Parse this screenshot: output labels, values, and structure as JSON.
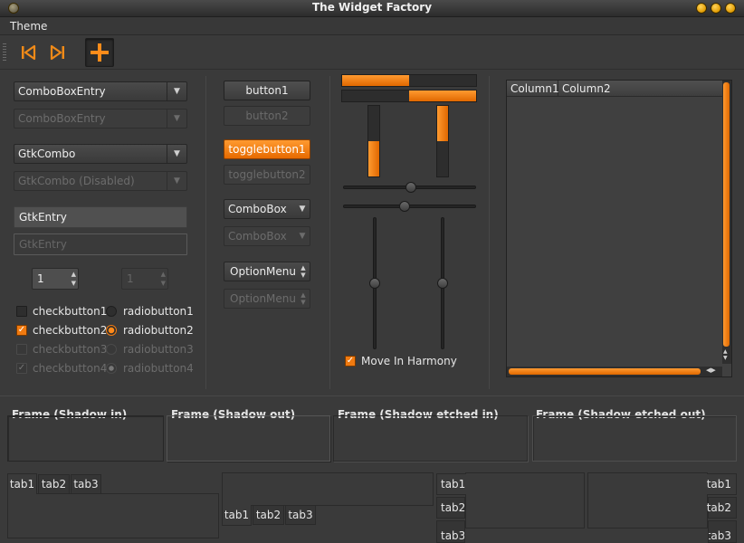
{
  "window": {
    "title": "The Widget Factory"
  },
  "menubar": {
    "items": [
      "Theme"
    ]
  },
  "toolbar": {
    "buttons": [
      "skip-back-icon",
      "skip-forward-icon",
      "plus-icon"
    ]
  },
  "combos": {
    "entry": "ComboBoxEntry",
    "entry_disabled": "ComboBoxEntry",
    "gtk": "GtkCombo",
    "gtk_disabled": "GtkCombo (Disabled)"
  },
  "entries": {
    "entry": "GtkEntry",
    "entry_disabled": "GtkEntry"
  },
  "spin": {
    "value": "1",
    "value_disabled": "1"
  },
  "checks": [
    {
      "label": "checkbutton1",
      "checked": false,
      "disabled": false
    },
    {
      "label": "checkbutton2",
      "checked": true,
      "disabled": false
    },
    {
      "label": "checkbutton3",
      "checked": false,
      "disabled": true
    },
    {
      "label": "checkbutton4",
      "checked": true,
      "disabled": true
    }
  ],
  "radios": [
    {
      "label": "radiobutton1",
      "selected": false,
      "disabled": false
    },
    {
      "label": "radiobutton2",
      "selected": true,
      "disabled": false
    },
    {
      "label": "radiobutton3",
      "selected": false,
      "disabled": true
    },
    {
      "label": "radiobutton4",
      "selected": true,
      "disabled": true
    }
  ],
  "buttons": {
    "button1": "button1",
    "button2": "button2",
    "toggle1": "togglebutton1",
    "toggle2": "togglebutton2",
    "combobox": "ComboBox",
    "combobox_disabled": "ComboBox",
    "optionmenu": "OptionMenu",
    "optionmenu_disabled": "OptionMenu"
  },
  "progress": {
    "h_top": 0.5,
    "h_bottom_start": 0.5,
    "v_left": 0.5,
    "v_right_start": 0.5
  },
  "scales": {
    "h1": 0.51,
    "h2": 0.5,
    "v1": 0.5,
    "v2": 0.5
  },
  "move_in_harmony": {
    "label": "Move In Harmony",
    "checked": true
  },
  "tree": {
    "columns": [
      "Column1",
      "Column2"
    ]
  },
  "frames": [
    {
      "title": "Frame (Shadow in)",
      "style": "in"
    },
    {
      "title": "Frame (Shadow out)",
      "style": "out"
    },
    {
      "title": "Frame (Shadow etched in)",
      "style": "etchin"
    },
    {
      "title": "Frame (Shadow etched out)",
      "style": "etchout"
    }
  ],
  "notebooks": {
    "top": [
      "tab1",
      "tab2",
      "tab3"
    ],
    "bottom": [
      "tab1",
      "tab2",
      "tab3"
    ],
    "left": [
      "tab1",
      "tab2",
      "tab3"
    ],
    "right": [
      "tab1",
      "tab2",
      "tab3"
    ]
  },
  "colors": {
    "accent": "#f07a10",
    "background": "#3a3a3a"
  }
}
